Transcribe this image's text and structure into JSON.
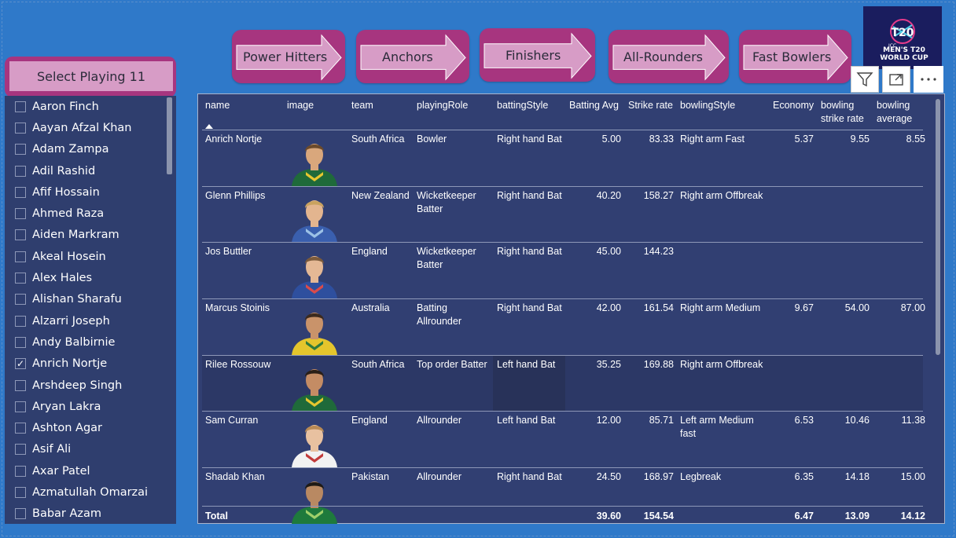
{
  "arrows": [
    {
      "label": "Power Hitters"
    },
    {
      "label": "Anchors"
    },
    {
      "label": "Finishers"
    },
    {
      "label": "All-Rounders"
    },
    {
      "label": "Fast Bowlers"
    }
  ],
  "slicer": {
    "title": "Select Playing 11",
    "items": [
      {
        "name": "Aaron Finch",
        "checked": false
      },
      {
        "name": "Aayan Afzal Khan",
        "checked": false
      },
      {
        "name": "Adam Zampa",
        "checked": false
      },
      {
        "name": "Adil Rashid",
        "checked": false
      },
      {
        "name": "Afif Hossain",
        "checked": false
      },
      {
        "name": "Ahmed Raza",
        "checked": false
      },
      {
        "name": "Aiden Markram",
        "checked": false
      },
      {
        "name": "Akeal Hosein",
        "checked": false
      },
      {
        "name": "Alex Hales",
        "checked": false
      },
      {
        "name": "Alishan Sharafu",
        "checked": false
      },
      {
        "name": "Alzarri Joseph",
        "checked": false
      },
      {
        "name": "Andy Balbirnie",
        "checked": false
      },
      {
        "name": "Anrich Nortje",
        "checked": true
      },
      {
        "name": "Arshdeep Singh",
        "checked": false
      },
      {
        "name": "Aryan Lakra",
        "checked": false
      },
      {
        "name": "Ashton Agar",
        "checked": false
      },
      {
        "name": "Asif Ali",
        "checked": false
      },
      {
        "name": "Axar Patel",
        "checked": false
      },
      {
        "name": "Azmatullah Omarzai",
        "checked": false
      },
      {
        "name": "Babar Azam",
        "checked": false
      }
    ]
  },
  "logo": {
    "line1": "ICC",
    "line2": "MEN'S T20",
    "line3": "WORLD CUP",
    "brand": "T20"
  },
  "icons": {
    "filter": "filter-icon",
    "focus": "focus-mode-icon",
    "more": "more-options-icon"
  },
  "table": {
    "headers": {
      "name": "name",
      "image": "image",
      "team": "team",
      "playingRole": "playingRole",
      "battingStyle": "battingStyle",
      "battingAvg": "Batting Avg",
      "strikeRate": "Strike rate",
      "bowlingStyle": "bowlingStyle",
      "economy": "Economy",
      "bowlingSR_1": "bowling",
      "bowlingSR_2": "strike rate",
      "bowlingAvg_1": "bowling",
      "bowlingAvg_2": "average"
    },
    "rows": [
      {
        "name": "Anrich Nortje",
        "team": "South Africa",
        "role1": "Bowler",
        "role2": "",
        "batting": "Right hand Bat",
        "avg": "5.00",
        "sr": "83.33",
        "bowl1": "Right arm Fast",
        "bowl2": "",
        "econ": "5.37",
        "bsr": "9.55",
        "bavg": "8.55",
        "jersey": "#1f6a3a",
        "jersey2": "#e6c62f",
        "skin": "#d9a77c",
        "hair": "#6b4a2b"
      },
      {
        "name": "Glenn Phillips",
        "team": "New Zealand",
        "role1": "Wicketkeeper",
        "role2": "Batter",
        "batting": "Right hand Bat",
        "avg": "40.20",
        "sr": "158.27",
        "bowl1": "Right arm Offbreak",
        "bowl2": "",
        "econ": "",
        "bsr": "",
        "bavg": "",
        "jersey": "#3a5fae",
        "jersey2": "#9cc1e6",
        "skin": "#e3b58f",
        "hair": "#c9a25f"
      },
      {
        "name": "Jos Buttler",
        "team": "England",
        "role1": "Wicketkeeper",
        "role2": "Batter",
        "batting": "Right hand Bat",
        "avg": "45.00",
        "sr": "144.23",
        "bowl1": "",
        "bowl2": "",
        "econ": "",
        "bsr": "",
        "bavg": "",
        "jersey": "#2e4f9e",
        "jersey2": "#d94b4b",
        "skin": "#e4b895",
        "hair": "#7b5a3b"
      },
      {
        "name": "Marcus Stoinis",
        "team": "Australia",
        "role1": "Batting",
        "role2": "Allrounder",
        "batting": "Right hand Bat",
        "avg": "42.00",
        "sr": "161.54",
        "bowl1": "Right arm Medium",
        "bowl2": "",
        "econ": "9.67",
        "bsr": "54.00",
        "bavg": "87.00",
        "jersey": "#e4c52c",
        "jersey2": "#2f7a3c",
        "skin": "#c9936a",
        "hair": "#3b2a1e"
      },
      {
        "name": "Rilee Rossouw",
        "team": "South Africa",
        "role1": "Top order Batter",
        "role2": "",
        "batting": "Left hand Bat",
        "avg": "35.25",
        "sr": "169.88",
        "bowl1": "Right arm Offbreak",
        "bowl2": "",
        "econ": "",
        "bsr": "",
        "bavg": "",
        "jersey": "#1f6a3a",
        "jersey2": "#e6c62f",
        "skin": "#c48c64",
        "hair": "#2a1f17"
      },
      {
        "name": "Sam Curran",
        "team": "England",
        "role1": "Allrounder",
        "role2": "",
        "batting": "Left hand Bat",
        "avg": "12.00",
        "sr": "85.71",
        "bowl1": "Left arm Medium",
        "bowl2": "fast",
        "econ": "6.53",
        "bsr": "10.46",
        "bavg": "11.38",
        "jersey": "#f2f2f2",
        "jersey2": "#c23b3b",
        "skin": "#e8c1a0",
        "hair": "#b88a55"
      },
      {
        "name": "Shadab Khan",
        "team": "Pakistan",
        "role1": "Allrounder",
        "role2": "",
        "batting": "Right hand Bat",
        "avg": "24.50",
        "sr": "168.97",
        "bowl1": "Legbreak",
        "bowl2": "",
        "econ": "6.35",
        "bsr": "14.18",
        "bavg": "15.00",
        "jersey": "#1e7a3c",
        "jersey2": "#9fd06a",
        "skin": "#b98962",
        "hair": "#1e1a16"
      }
    ],
    "total": {
      "label": "Total",
      "avg": "39.60",
      "sr": "154.54",
      "econ": "6.47",
      "bsr": "13.09",
      "bavg": "14.12"
    }
  }
}
